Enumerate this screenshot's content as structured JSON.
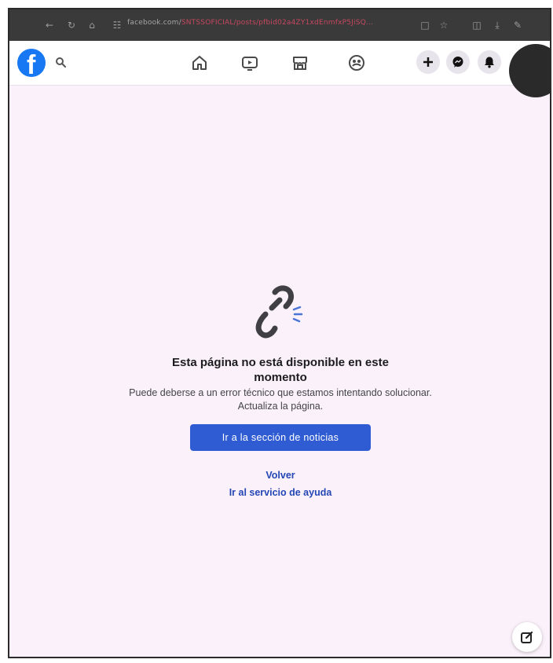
{
  "browser": {
    "url_domain": "facebook.com/",
    "url_path": "SNTSSOFICIAL/posts/pfbid02a4ZY1xdEnmfxP5JiSQ..."
  },
  "header": {
    "logo_letter": "f",
    "nav_icons": [
      "home-icon",
      "video-icon",
      "marketplace-icon",
      "groups-icon"
    ],
    "action_icons": [
      "create-icon",
      "messenger-icon",
      "notifications-icon"
    ]
  },
  "error": {
    "title": "Esta página no está disponible en este momento",
    "description": "Puede deberse a un error técnico que estamos intentando solucionar. Actualiza la página.",
    "primary_button": "Ir a la sección de noticias",
    "back_link": "Volver",
    "help_link": "Ir al servicio de ayuda"
  },
  "colors": {
    "accent": "#2f5bd3",
    "link": "#2446b4",
    "facebook_blue": "#1877f2",
    "background": "#fbf1fb"
  }
}
